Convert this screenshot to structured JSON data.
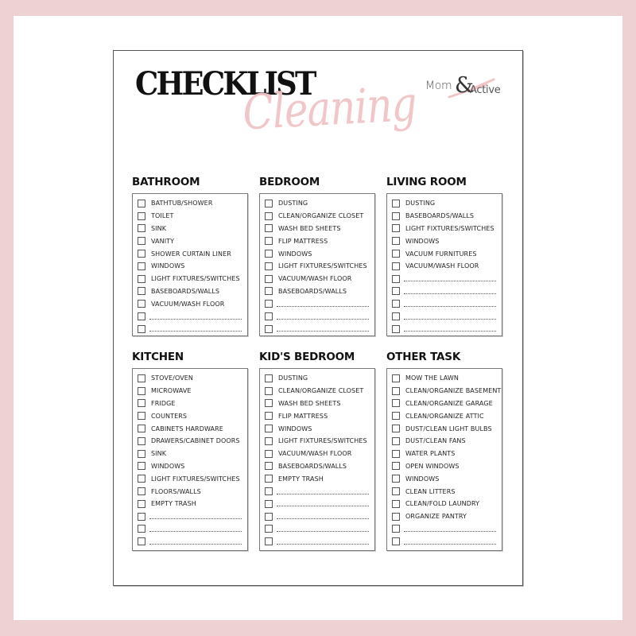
{
  "document": {
    "title": "CHECKLIST",
    "subtitle": "Cleaning",
    "logo": {
      "part1": "Mom",
      "ampersand": "&",
      "part2": "Active"
    },
    "colors": {
      "frame": "#eed2d3",
      "accent_pink": "#f1c4c6",
      "text": "#111111"
    }
  },
  "sections": [
    {
      "heading": "BATHROOM",
      "items": [
        "BATHTUB/SHOWER",
        "TOILET",
        "SINK",
        "VANITY",
        "SHOWER CURTAIN LINER",
        "WINDOWS",
        "LIGHT FIXTURES/SWITCHES",
        "BASEBOARDS/WALLS",
        "VACUUM/WASH FLOOR"
      ],
      "blank_lines": 2
    },
    {
      "heading": "BEDROOM",
      "items": [
        "DUSTING",
        "CLEAN/ORGANIZE CLOSET",
        "WASH BED SHEETS",
        "FLIP MATTRESS",
        "WINDOWS",
        "LIGHT FIXTURES/SWITCHES",
        "VACUUM/WASH FLOOR",
        "BASEBOARDS/WALLS"
      ],
      "blank_lines": 3
    },
    {
      "heading": "LIVING ROOM",
      "items": [
        "DUSTING",
        "BASEBOARDS/WALLS",
        "LIGHT FIXTURES/SWITCHES",
        "WINDOWS",
        "VACUUM FURNITURES",
        "VACUUM/WASH FLOOR"
      ],
      "blank_lines": 5
    },
    {
      "heading": "KITCHEN",
      "items": [
        "STOVE/OVEN",
        "MICROWAVE",
        "FRIDGE",
        "COUNTERS",
        "CABINETS HARDWARE",
        "DRAWERS/CABINET DOORS",
        "SINK",
        "WINDOWS",
        "LIGHT FIXTURES/SWITCHES",
        "FLOORS/WALLS",
        "EMPTY TRASH"
      ],
      "blank_lines": 3
    },
    {
      "heading": "KID'S BEDROOM",
      "items": [
        "DUSTING",
        "CLEAN/ORGANIZE CLOSET",
        "WASH BED SHEETS",
        "FLIP MATTRESS",
        "WINDOWS",
        "LIGHT FIXTURES/SWITCHES",
        "VACUUM/WASH FLOOR",
        "BASEBOARDS/WALLS",
        "EMPTY TRASH"
      ],
      "blank_lines": 5
    },
    {
      "heading": "OTHER TASK",
      "items": [
        "MOW THE LAWN",
        "CLEAN/ORGANIZE BASEMENT",
        "CLEAN/ORGANIZE GARAGE",
        "CLEAN/ORGANIZE ATTIC",
        "DUST/CLEAN LIGHT BULBS",
        "DUST/CLEAN FANS",
        "WATER PLANTS",
        "OPEN WINDOWS",
        "WINDOWS",
        "CLEAN LITTERS",
        "CLEAN/FOLD LAUNDRY",
        "ORGANIZE PANTRY"
      ],
      "blank_lines": 2
    }
  ]
}
